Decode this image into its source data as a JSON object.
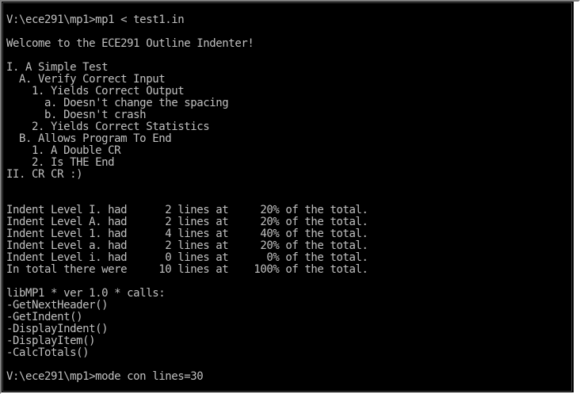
{
  "console": {
    "lines": [
      "V:\\ece291\\mp1>mp1 < test1.in",
      "",
      "Welcome to the ECE291 Outline Indenter!",
      "",
      "I. A Simple Test",
      "  A. Verify Correct Input",
      "    1. Yields Correct Output",
      "      a. Doesn't change the spacing",
      "      b. Doesn't crash",
      "    2. Yields Correct Statistics",
      "  B. Allows Program To End",
      "    1. A Double CR",
      "    2. Is THE End",
      "II. CR CR :)",
      "",
      "",
      "Indent Level I. had      2 lines at     20% of the total.",
      "Indent Level A. had      2 lines at     20% of the total.",
      "Indent Level 1. had      4 lines at     40% of the total.",
      "Indent Level a. had      2 lines at     20% of the total.",
      "Indent Level i. had      0 lines at      0% of the total.",
      "In total there were     10 lines at    100% of the total.",
      "",
      "libMP1 * ver 1.0 * calls:",
      "-GetNextHeader()",
      "-GetIndent()",
      "-DisplayIndent()",
      "-DisplayItem()",
      "-CalcTotals()",
      "",
      "V:\\ece291\\mp1>mode con lines=30"
    ]
  },
  "colors": {
    "background": "#000000",
    "text": "#c0c0c0"
  }
}
